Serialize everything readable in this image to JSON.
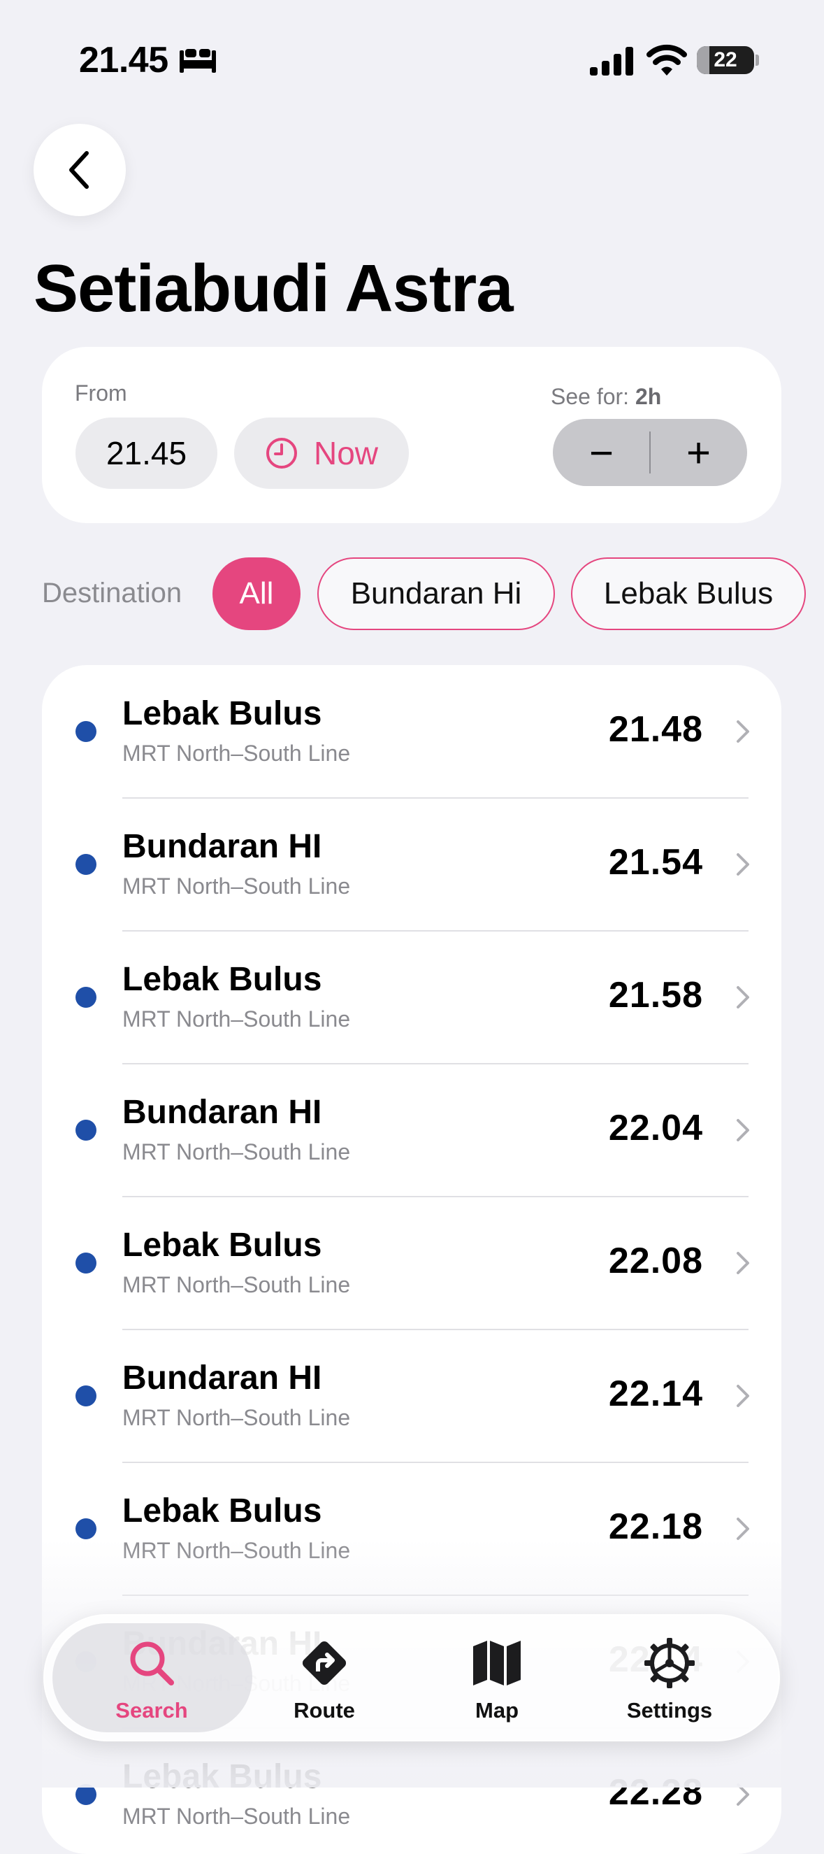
{
  "status_bar": {
    "time": "21.45",
    "battery": "22",
    "battery_level": 0.22
  },
  "title": "Setiabudi Astra",
  "from_card": {
    "from_label": "From",
    "time": "21.45",
    "now_label": "Now",
    "see_for_label": "See for:",
    "see_for_value": "2h",
    "minus": "−",
    "plus": "+"
  },
  "destination": {
    "label": "Destination",
    "chips": [
      "All",
      "Bundaran Hi",
      "Lebak Bulus"
    ],
    "selected": "All"
  },
  "departures": [
    {
      "destination": "Lebak Bulus",
      "line": "MRT North–South Line",
      "time": "21.48"
    },
    {
      "destination": "Bundaran HI",
      "line": "MRT North–South Line",
      "time": "21.54"
    },
    {
      "destination": "Lebak Bulus",
      "line": "MRT North–South Line",
      "time": "21.58"
    },
    {
      "destination": "Bundaran HI",
      "line": "MRT North–South Line",
      "time": "22.04"
    },
    {
      "destination": "Lebak Bulus",
      "line": "MRT North–South Line",
      "time": "22.08"
    },
    {
      "destination": "Bundaran HI",
      "line": "MRT North–South Line",
      "time": "22.14"
    },
    {
      "destination": "Lebak Bulus",
      "line": "MRT North–South Line",
      "time": "22.18"
    },
    {
      "destination": "Bundaran HI",
      "line": "MRT North–South Line",
      "time": "22.24"
    },
    {
      "destination": "Lebak Bulus",
      "line": "MRT North–South Line",
      "time": "22.28"
    }
  ],
  "tabs": [
    {
      "label": "Search",
      "icon": "search-icon",
      "active": true
    },
    {
      "label": "Route",
      "icon": "route-icon",
      "active": false
    },
    {
      "label": "Map",
      "icon": "map-icon",
      "active": false
    },
    {
      "label": "Settings",
      "icon": "gear-icon",
      "active": false
    }
  ],
  "colors": {
    "accent": "#E5467F",
    "line_dot": "#1F4FA8",
    "background": "#F1F1F6"
  }
}
